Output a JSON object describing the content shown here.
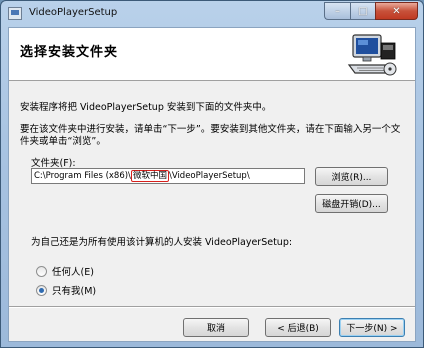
{
  "window": {
    "title": "VideoPlayerSetup",
    "app_icon": "installer-icon"
  },
  "caption_buttons": {
    "minimize": "–",
    "maximize": "□",
    "close": "✕"
  },
  "header": {
    "title": "选择安装文件夹",
    "icon": "computer-install-icon"
  },
  "body": {
    "line1": "安装程序将把 VideoPlayerSetup 安装到下面的文件夹中。",
    "line2": "要在该文件夹中进行安装，请单击“下一步”。要安装到其他文件夹，请在下面输入另一个文",
    "line3": "件夹或单击“浏览”。"
  },
  "folder": {
    "label": "文件夹(F):",
    "path_prefix": "C:\\Program Files (x86)\\",
    "path_highlight": "微软中国",
    "path_suffix": "\\VideoPlayerSetup\\",
    "highlight_color": "#d6201c"
  },
  "buttons": {
    "browse": "浏览(R)...",
    "disk_cost": "磁盘开销(D)...",
    "cancel": "取消",
    "back": "< 后退(B)",
    "next": "下一步(N) >"
  },
  "install_for": {
    "question": "为自己还是为所有使用该计算机的人安装 VideoPlayerSetup:",
    "options": [
      {
        "label": "任何人(E)",
        "checked": false
      },
      {
        "label": "只有我(M)",
        "checked": true
      }
    ]
  }
}
